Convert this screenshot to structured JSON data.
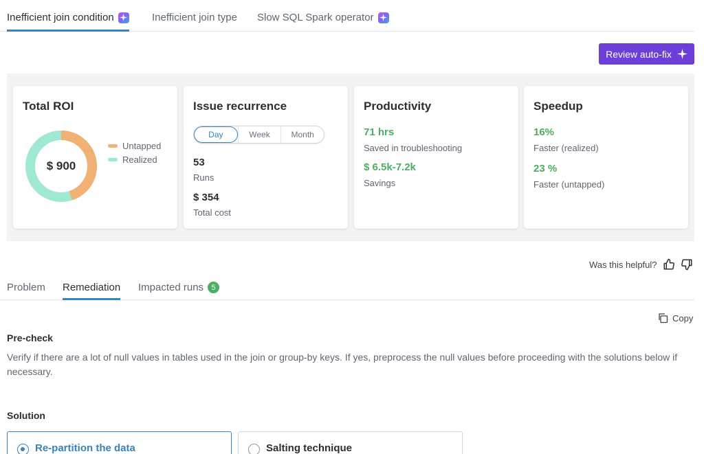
{
  "top_tabs": [
    {
      "label": "Inefficient join condition",
      "ai": true,
      "active": true
    },
    {
      "label": "Inefficient join type",
      "ai": false,
      "active": false
    },
    {
      "label": "Slow SQL Spark operator",
      "ai": true,
      "active": false
    }
  ],
  "review_button": {
    "label": "Review auto-fix",
    "icon": "sparkle-icon"
  },
  "roi_card": {
    "title": "Total ROI",
    "center_value": "$ 900",
    "donut": {
      "untapped_fraction": 0.45,
      "realized_fraction": 0.55
    },
    "legend": [
      {
        "label": "Untapped",
        "color": "#f0b273"
      },
      {
        "label": "Realized",
        "color": "#9ee8d4"
      }
    ]
  },
  "recurrence_card": {
    "title": "Issue recurrence",
    "segments": [
      {
        "label": "Day",
        "active": true
      },
      {
        "label": "Week",
        "active": false
      },
      {
        "label": "Month",
        "active": false
      }
    ],
    "runs_value": "53",
    "runs_label": "Runs",
    "cost_value": "$ 354",
    "cost_label": "Total cost"
  },
  "productivity_card": {
    "title": "Productivity",
    "hours_value": "71 hrs",
    "hours_label": "Saved in troubleshooting",
    "savings_value": "$ 6.5k-7.2k",
    "savings_label": "Savings"
  },
  "speedup_card": {
    "title": "Speedup",
    "realized_value": "16%",
    "realized_label": "Faster (realized)",
    "untapped_value": "23 %",
    "untapped_label": "Faster (untapped)"
  },
  "feedback": {
    "label": "Was this helpful?",
    "up_icon": "thumbs-up-icon",
    "down_icon": "thumbs-down-icon"
  },
  "sub_tabs": [
    {
      "label": "Problem",
      "active": false
    },
    {
      "label": "Remediation",
      "active": true
    },
    {
      "label": "Impacted runs",
      "active": false,
      "badge": "5"
    }
  ],
  "copy": {
    "label": "Copy",
    "icon": "copy-icon"
  },
  "precheck": {
    "heading": "Pre-check",
    "text": "Verify if there are a lot of null values in tables used in the join or group-by keys. If yes, preprocess the null values before proceeding with the solutions below if necessary."
  },
  "solution": {
    "heading": "Solution",
    "options": [
      {
        "label": "Re-partition the data",
        "selected": true
      },
      {
        "label": "Salting technique",
        "selected": false
      }
    ]
  },
  "colors": {
    "accent": "#3a83b8",
    "primary_button": "#6e3fd8",
    "positive": "#4cae62"
  }
}
